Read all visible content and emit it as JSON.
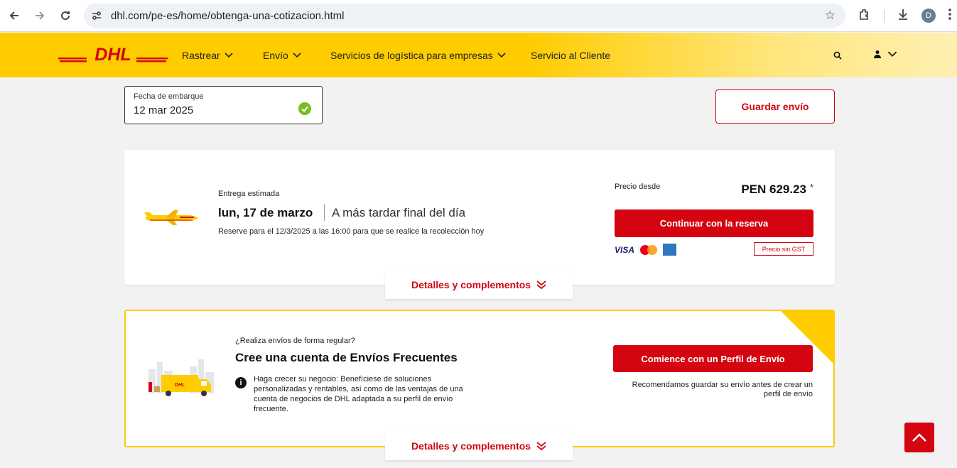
{
  "browser": {
    "url": "dhl.com/pe-es/home/obtenga-una-cotizacion.html",
    "profile_initial": "D"
  },
  "header": {
    "logo_text": "DHL",
    "menu": [
      {
        "label": "Rastrear"
      },
      {
        "label": "Envío"
      },
      {
        "label": "Servicios de logística para empresas"
      },
      {
        "label": "Servicio al Cliente"
      }
    ]
  },
  "shipment": {
    "date_label": "Fecha de embarque",
    "date_value": "12 mar 2025",
    "save_label": "Guardar envío"
  },
  "quote": {
    "estimate_label": "Entrega estimada",
    "delivery_date": "lun, 17 de marzo",
    "delivery_time": "A más tardar final del día",
    "pickup_note": "Reserve para el 12/3/2025 a las 16:00 para que se realice la recolección hoy",
    "price_label": "Precio desde",
    "price": "PEN 629.23",
    "price_asterisk": "*",
    "continue_label": "Continuar con la reserva",
    "payment_visa": "VISA",
    "gst_label": "Precio sin GST",
    "details_label": "Detalles y complementos"
  },
  "regular": {
    "question": "¿Realiza envíos de forma regular?",
    "title": "Cree una cuenta de Envíos Frecuentes",
    "description": "Haga crecer su negocio: Benefíciese de soluciones personalizadas y rentables, así como de las ventajas de una cuenta de negocios de DHL adaptada a su perfil de envío frecuente.",
    "profile_button": "Comience con un Perfil de Envío",
    "recommendation": "Recomendamos guardar su envío antes de crear un perfil de envío",
    "details_label": "Detalles y complementos"
  },
  "colors": {
    "brand_yellow": "#ffcc00",
    "brand_red": "#d40511",
    "success_green": "#76bd22"
  },
  "icons": [
    "back-icon",
    "forward-icon",
    "reload-icon",
    "site-settings-icon",
    "bookmark-star-icon",
    "extensions-icon",
    "download-icon",
    "more-icon",
    "chevron-down-icon",
    "search-icon",
    "user-icon",
    "check-icon",
    "plane-icon",
    "mastercard-icon",
    "amex-icon",
    "double-chevron-down-icon",
    "truck-icon",
    "info-icon",
    "arrow-up-icon"
  ]
}
